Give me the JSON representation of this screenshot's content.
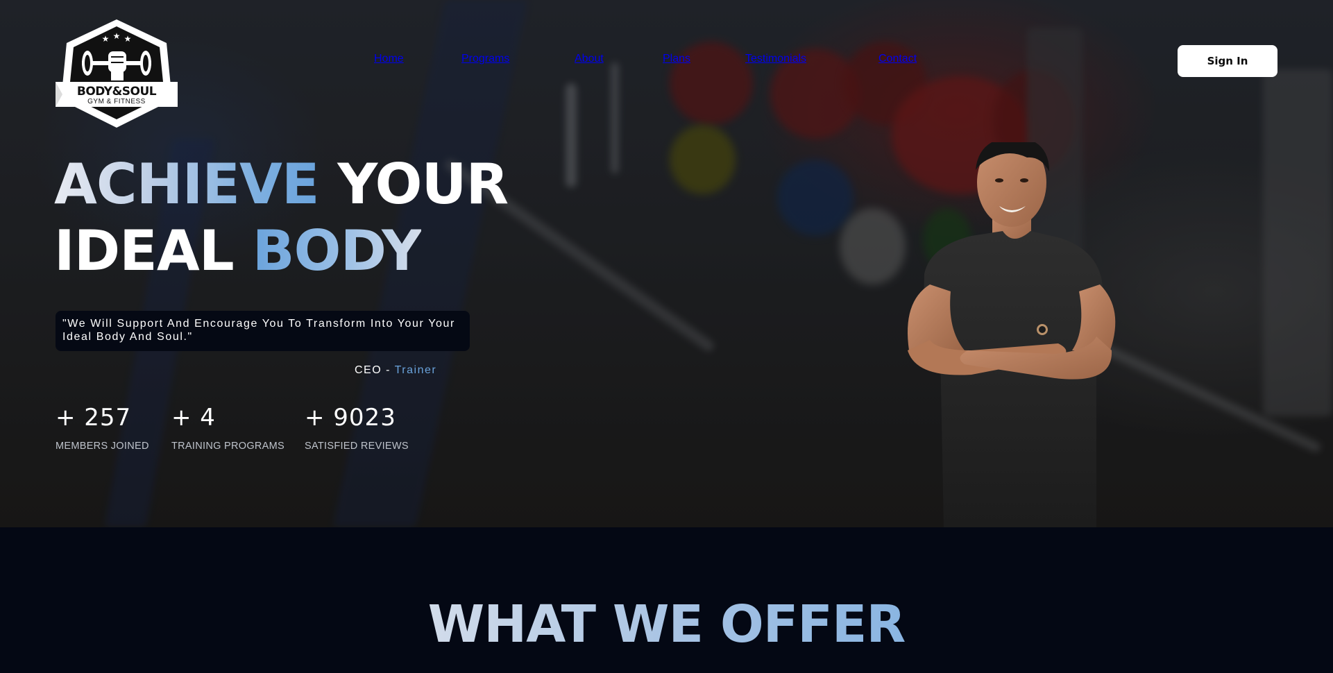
{
  "brand": {
    "name": "BODY&SOUL",
    "tagline": "GYM & FITNESS"
  },
  "nav": {
    "items": [
      {
        "label": "Home"
      },
      {
        "label": "Programs"
      },
      {
        "label": "About"
      },
      {
        "label": "Plans"
      },
      {
        "label": "Testimonials"
      },
      {
        "label": "Contact"
      }
    ],
    "signin_label": "Sign In"
  },
  "hero": {
    "headline_line1_a": "ACHIEVE",
    "headline_line1_b": "YOUR",
    "headline_line2_a": "IDEAL",
    "headline_line2_b": "BODY",
    "quote": "\"We Will Support And Encourage You To Transform Into Your Your Ideal Body And Soul.\"",
    "attribution_title": "CEO",
    "attribution_sep": "-",
    "attribution_role": "Trainer",
    "stats": [
      {
        "value": "+ 257",
        "label": "MEMBERS JOINED"
      },
      {
        "value": "+ 4",
        "label": "TRAINING PROGRAMS"
      },
      {
        "value": "+ 9023",
        "label": "SATISFIED REVIEWS"
      }
    ]
  },
  "offer": {
    "heading": "WHAT WE OFFER"
  },
  "colors": {
    "accent": "#6aa3dc",
    "dark_bg": "#040814",
    "button_bg": "#ffffff"
  },
  "icons": {
    "logo": "dumbbell-fist-hexagon-logo"
  }
}
